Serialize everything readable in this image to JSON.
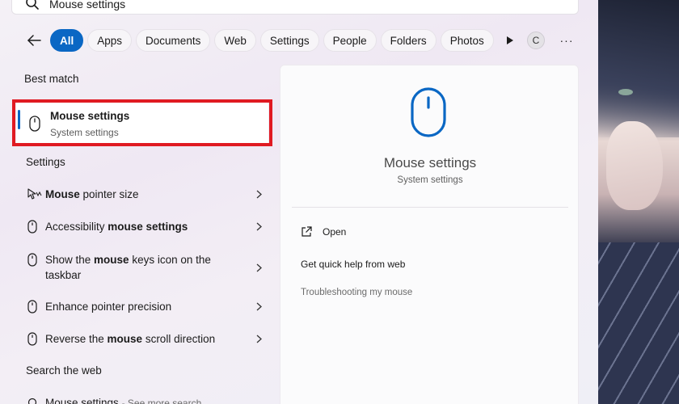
{
  "search": {
    "query": "Mouse settings"
  },
  "filters": {
    "tabs": [
      "All",
      "Apps",
      "Documents",
      "Web",
      "Settings",
      "People",
      "Folders",
      "Photos"
    ],
    "active": "All",
    "avatar_initial": "C",
    "more_label": "···"
  },
  "left": {
    "best_match_title": "Best match",
    "best_match": {
      "title": "Mouse settings",
      "subtitle": "System settings"
    },
    "settings_title": "Settings",
    "settings_items": [
      {
        "pre": "",
        "bold": "Mouse",
        "post": " pointer size",
        "line2": ""
      },
      {
        "pre": "Accessibility ",
        "bold": "mouse settings",
        "post": "",
        "line2": ""
      },
      {
        "pre": "Show the ",
        "bold": "mouse",
        "post": " keys icon on the",
        "line2": "taskbar"
      },
      {
        "pre": "Enhance pointer precision",
        "bold": "",
        "post": "",
        "line2": ""
      },
      {
        "pre": "Reverse the ",
        "bold": "mouse",
        "post": " scroll direction",
        "line2": ""
      }
    ],
    "web_title": "Search the web",
    "web_item": {
      "text": "Mouse settings",
      "hint": "- See more search"
    }
  },
  "preview": {
    "title": "Mouse settings",
    "subtitle": "System settings",
    "actions": {
      "open": "Open",
      "help": "Get quick help from web",
      "troubleshoot": "Troubleshooting my mouse"
    }
  },
  "colors": {
    "accent": "#0a67c4",
    "highlight_box": "#e01a22"
  }
}
